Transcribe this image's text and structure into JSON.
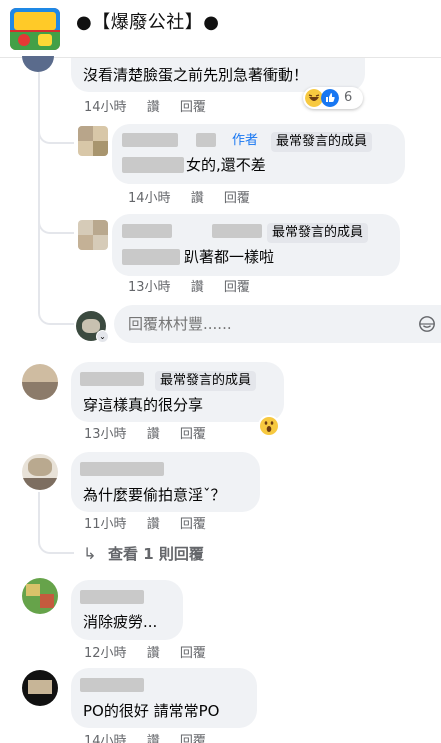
{
  "header": {
    "group_name": "●【爆廢公社】●"
  },
  "actions": {
    "like": "讚",
    "reply": "回覆"
  },
  "comments": [
    {
      "text": "沒看清楚臉蛋之前先別急著衝動！",
      "time": "14小時",
      "reaction_count": "6"
    },
    {
      "text": "女的,還不差",
      "time": "14小時",
      "author_label": "作者",
      "badge": "最常發言的成員"
    },
    {
      "text": "趴著都一樣啦",
      "time": "13小時",
      "badge": "最常發言的成員"
    },
    {
      "text": "穿這樣真的很分享",
      "time": "13小時",
      "badge": "最常發言的成員"
    },
    {
      "text": "為什麼要偷拍意淫ˇ？",
      "time": "11小時"
    },
    {
      "text": "消除疲勞...",
      "time": "12小時"
    },
    {
      "text": "PO的很好 請常常PO",
      "time": "14小時"
    }
  ],
  "reply_input": {
    "placeholder": "回覆林村豐......"
  },
  "view_more_replies": "查看 1 則回覆",
  "colors": {
    "bubble": "#f0f2f5",
    "meta": "#65676b",
    "author": "#1877f2"
  }
}
